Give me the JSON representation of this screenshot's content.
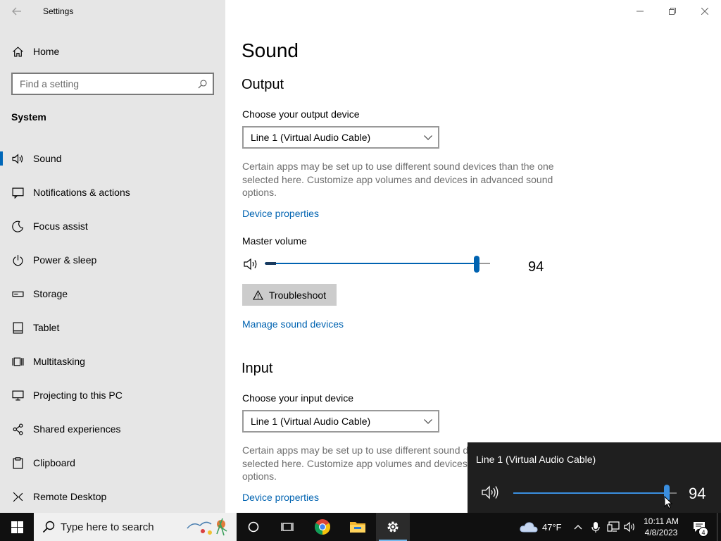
{
  "window": {
    "app_title": "Settings",
    "controls": [
      "minimize",
      "restore",
      "close"
    ]
  },
  "sidebar": {
    "home_label": "Home",
    "search_placeholder": "Find a setting",
    "section_heading": "System",
    "items": [
      {
        "label": "Sound",
        "icon": "speaker-icon",
        "active": true
      },
      {
        "label": "Notifications & actions",
        "icon": "notification-icon"
      },
      {
        "label": "Focus assist",
        "icon": "moon-icon"
      },
      {
        "label": "Power & sleep",
        "icon": "power-icon"
      },
      {
        "label": "Storage",
        "icon": "storage-icon"
      },
      {
        "label": "Tablet",
        "icon": "tablet-icon"
      },
      {
        "label": "Multitasking",
        "icon": "multitasking-icon"
      },
      {
        "label": "Projecting to this PC",
        "icon": "projecting-icon"
      },
      {
        "label": "Shared experiences",
        "icon": "shared-icon"
      },
      {
        "label": "Clipboard",
        "icon": "clipboard-icon"
      },
      {
        "label": "Remote Desktop",
        "icon": "remote-desktop-icon"
      }
    ]
  },
  "main": {
    "title": "Sound",
    "output": {
      "heading": "Output",
      "device_label": "Choose your output device",
      "device_value": "Line 1 (Virtual Audio Cable)",
      "description": "Certain apps may be set up to use different sound devices than the one selected here. Customize app volumes and devices in advanced sound options.",
      "device_properties_link": "Device properties",
      "master_volume_label": "Master volume",
      "master_volume_value": "94",
      "master_volume_level": 0.94,
      "troubleshoot_label": "Troubleshoot",
      "manage_link": "Manage sound devices"
    },
    "input": {
      "heading": "Input",
      "device_label": "Choose your input device",
      "device_value": "Line 1 (Virtual Audio Cable)",
      "description": "Certain apps may be set up to use different sound devices than the one selected here. Customize app volumes and devices in advanced sound options.",
      "device_properties_link": "Device properties"
    }
  },
  "flyout": {
    "device_name": "Line 1 (Virtual Audio Cable)",
    "volume_value": "94",
    "volume_level": 0.94
  },
  "taskbar": {
    "search_placeholder": "Type here to search",
    "weather_temp": "47°F",
    "time": "10:11 AM",
    "date": "4/8/2023",
    "notification_count": "4"
  },
  "colors": {
    "accent": "#0063b1",
    "sidebar_bg": "#e6e6e6",
    "taskbar_bg": "#101010",
    "flyout_bg": "#1f1f1f"
  }
}
